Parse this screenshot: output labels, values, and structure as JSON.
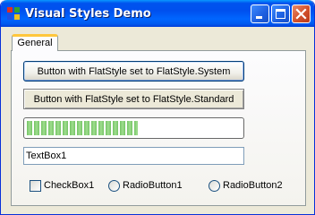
{
  "window": {
    "title": "Visual Styles Demo",
    "titlebar_color": "#0054e3"
  },
  "tabs": [
    {
      "label": "General",
      "selected": true
    }
  ],
  "buttons": {
    "system_label": "Button with FlatStyle set to FlatStyle.System",
    "standard_label": "Button with FlatStyle set to FlatStyle.Standard"
  },
  "progress": {
    "value_fraction": 0.52,
    "fill_color": "#74c465"
  },
  "textbox": {
    "value": "TextBox1"
  },
  "checkbox": {
    "label": "CheckBox1",
    "checked": false
  },
  "radios": [
    {
      "label": "RadioButton1",
      "selected": false
    },
    {
      "label": "RadioButton2",
      "selected": false
    }
  ]
}
